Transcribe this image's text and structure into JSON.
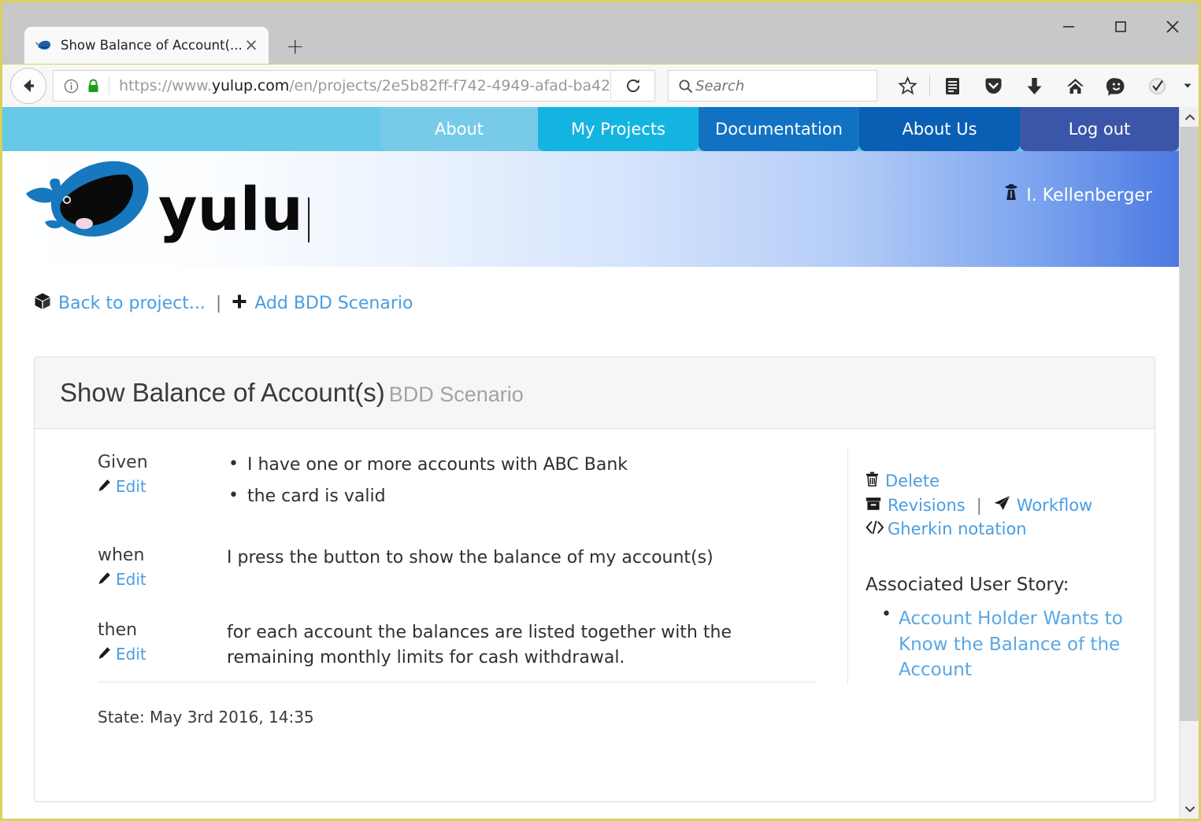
{
  "browser": {
    "tab": {
      "title": "Show Balance of Account(...",
      "favicon": "whale-icon",
      "close_label": "×"
    },
    "new_tab_label": "+",
    "window_controls": {
      "minimize": "minimize-icon",
      "maximize": "maximize-icon",
      "close": "close-icon"
    },
    "url": {
      "prefix": "https://www.",
      "domain": "yulup.com",
      "path": "/en/projects/2e5b82ff-f742-4949-afad-ba42"
    },
    "search": {
      "placeholder": "Search",
      "value": ""
    },
    "toolbar_icons": [
      "star-icon",
      "reader-list-icon",
      "pocket-icon",
      "download-icon",
      "home-icon",
      "smiley-icon",
      "checkmark-badge-icon",
      "chevron-down-icon",
      "hamburger-menu-icon"
    ],
    "reload_icon": "reload-icon",
    "back_icon": "back-arrow-icon",
    "identity_icon": "info-icon",
    "lock_icon": "padlock-icon"
  },
  "site": {
    "nav_tabs": [
      {
        "label": "About",
        "color": "#77cbe8"
      },
      {
        "label": "My Projects",
        "color": "#14b4e0"
      },
      {
        "label": "Documentation",
        "color": "#1172c4"
      },
      {
        "label": "About Us",
        "color": "#0a5fb4"
      },
      {
        "label": "Log out",
        "color": "#3b55a8"
      }
    ],
    "logo_alt": "yulup",
    "logo_wordmark": "yulup",
    "user": {
      "name": "I. Kellenberger",
      "icon": "user-secret-icon"
    },
    "accent_color": "#4a9de0",
    "navbar_bg": "#66c9e8"
  },
  "actions": {
    "back_to_project": {
      "label": "Back to project...",
      "icon": "cube-icon"
    },
    "separator": "|",
    "add_scenario": {
      "label": "Add BDD Scenario",
      "icon": "plus-icon"
    }
  },
  "card": {
    "title": "Show Balance of Account(s)",
    "subtitle": "BDD Scenario",
    "steps": [
      {
        "label": "Given",
        "edit_label": "Edit",
        "edit_icon": "pencil-icon",
        "items": [
          "I have one or more accounts with ABC Bank",
          "the card is valid"
        ],
        "text": ""
      },
      {
        "label": "when",
        "edit_label": "Edit",
        "edit_icon": "pencil-icon",
        "items": [],
        "text": "I press the button to show the balance of my account(s)"
      },
      {
        "label": "then",
        "edit_label": "Edit",
        "edit_icon": "pencil-icon",
        "items": [],
        "text": "for each account the balances are listed together with the remaining monthly limits for cash withdrawal."
      }
    ],
    "state": "State: May 3rd 2016, 14:35"
  },
  "sidebar": {
    "delete": {
      "label": "Delete",
      "icon": "trash-icon"
    },
    "revisions": {
      "label": "Revisions",
      "icon": "archive-icon"
    },
    "separator": "|",
    "workflow": {
      "label": "Workflow",
      "icon": "paper-plane-icon"
    },
    "gherkin": {
      "label": "Gherkin notation",
      "icon": "code-icon"
    },
    "story_heading": "Associated User Story:",
    "stories": [
      "Account Holder Wants to Know the Balance of the Account"
    ]
  },
  "scrollbar": {
    "up": "chevron-up-icon",
    "down": "chevron-down-icon"
  }
}
